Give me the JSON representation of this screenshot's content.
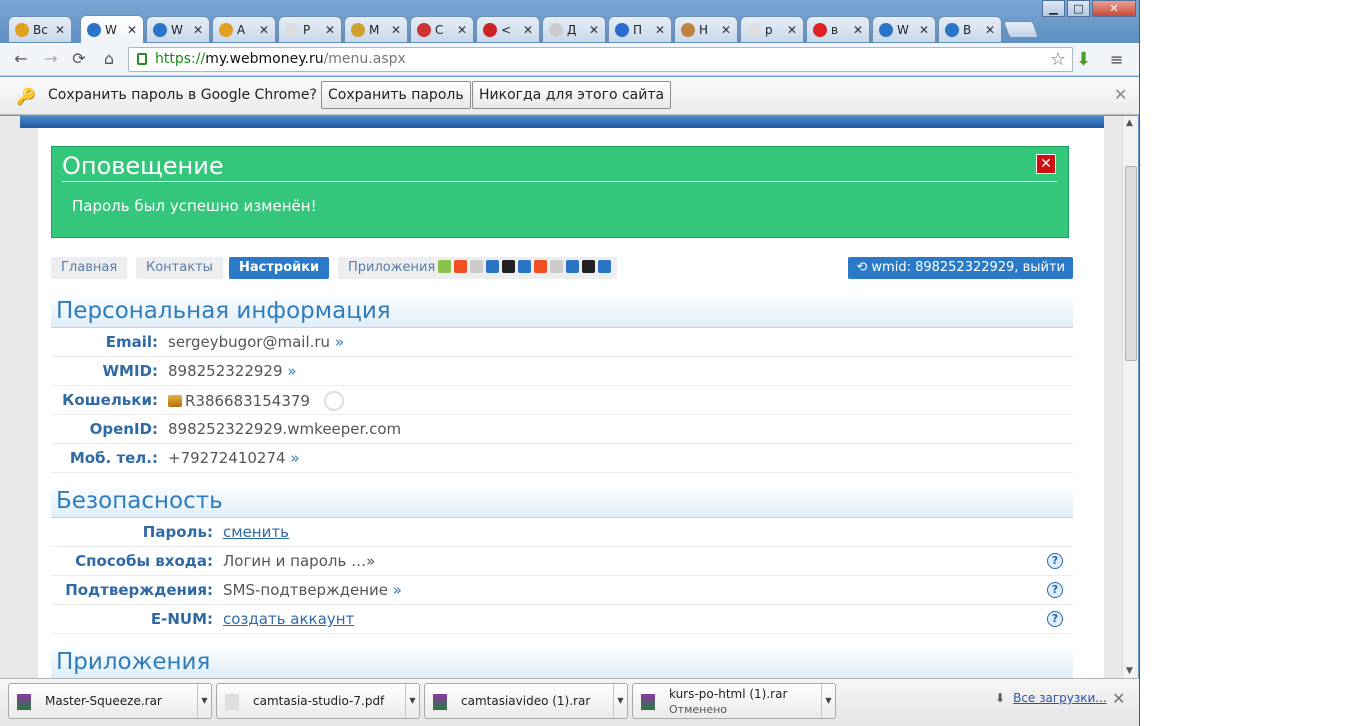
{
  "tabs": [
    {
      "title": "Вс",
      "icon_color": "#e0a020"
    },
    {
      "title": "W",
      "icon_color": "#2a75c8"
    },
    {
      "title": "W",
      "icon_color": "#2a75c8"
    },
    {
      "title": "A",
      "icon_color": "#e0a020"
    },
    {
      "title": "Р",
      "icon_color": "#dddddd"
    },
    {
      "title": "M",
      "icon_color": "#d0a030"
    },
    {
      "title": "C",
      "icon_color": "#cc3333"
    },
    {
      "title": "<",
      "icon_color": "#cc2222"
    },
    {
      "title": "Д",
      "icon_color": "#cccccc"
    },
    {
      "title": "П",
      "icon_color": "#2a6acb"
    },
    {
      "title": "Н",
      "icon_color": "#c08040"
    },
    {
      "title": "р",
      "icon_color": "#dddddd"
    },
    {
      "title": "в",
      "icon_color": "#dd2222"
    },
    {
      "title": "W",
      "icon_color": "#2a75c8"
    },
    {
      "title": "В",
      "icon_color": "#2a75c8"
    }
  ],
  "tab_close": "✕",
  "window": {
    "minimize": "▁",
    "maximize": "□",
    "close": "✕"
  },
  "toolbar": {
    "back": "←",
    "forward": "→",
    "reload": "⟳",
    "home": "⌂",
    "url_scheme": "https://",
    "url_domain": "my.webmoney.ru",
    "url_path": "/menu.aspx",
    "star": "☆",
    "download": "⬇",
    "menu": "≡"
  },
  "infobar": {
    "key_icon": "🔑",
    "message": "Сохранить пароль в Google Chrome?",
    "save": "Сохранить пароль",
    "never": "Никогда для этого сайта",
    "close": "✕"
  },
  "alert": {
    "title": "Оповещение",
    "text": "Пароль был успешно изменён!",
    "close": "✕"
  },
  "nav": {
    "home": "Главная",
    "contacts": "Контакты",
    "settings": "Настройки",
    "apps": "Приложения",
    "wmid_button": "wmid: 898252322929, выйти",
    "apps_icon_colors": [
      "#8bc34a",
      "#f25022",
      "#cccccc",
      "#2a75c8",
      "#222222",
      "#2a75c8",
      "#f25022",
      "#cccccc",
      "#2a75c8",
      "#222222",
      "#2a75c8"
    ]
  },
  "personal": {
    "title": "Персональная информация",
    "email_label": "Email:",
    "email_value": "sergeybugor@mail.ru",
    "arrow": "»",
    "wmid_label": "WMID:",
    "wmid_value": "898252322929",
    "wallets_label": "Кошельки:",
    "wallets_value": "R386683154379",
    "openid_label": "OpenID:",
    "openid_value": "898252322929.wmkeeper.com",
    "phone_label": "Моб. тел.:",
    "phone_value": "+79272410274"
  },
  "security": {
    "title": "Безопасность",
    "password_label": "Пароль:",
    "password_value": "сменить",
    "login_label": "Способы входа:",
    "login_value": "Логин и пароль …»",
    "confirm_label": "Подтверждения:",
    "confirm_value": "SMS-подтверждение",
    "enum_label": "E-NUM:",
    "enum_value": "создать аккаунт",
    "help": "?"
  },
  "apps_section": {
    "title": "Приложения"
  },
  "downloads": [
    {
      "name": "Master-Squeeze.rar",
      "status": ""
    },
    {
      "name": "camtasia-studio-7.pdf",
      "status": ""
    },
    {
      "name": "camtasiavideo (1).rar",
      "status": ""
    },
    {
      "name": "kurs-po-html (1).rar",
      "status": "Отменено"
    }
  ],
  "downloads_all": "Все загрузки...",
  "downloads_close": "✕",
  "dropdown": "▼"
}
